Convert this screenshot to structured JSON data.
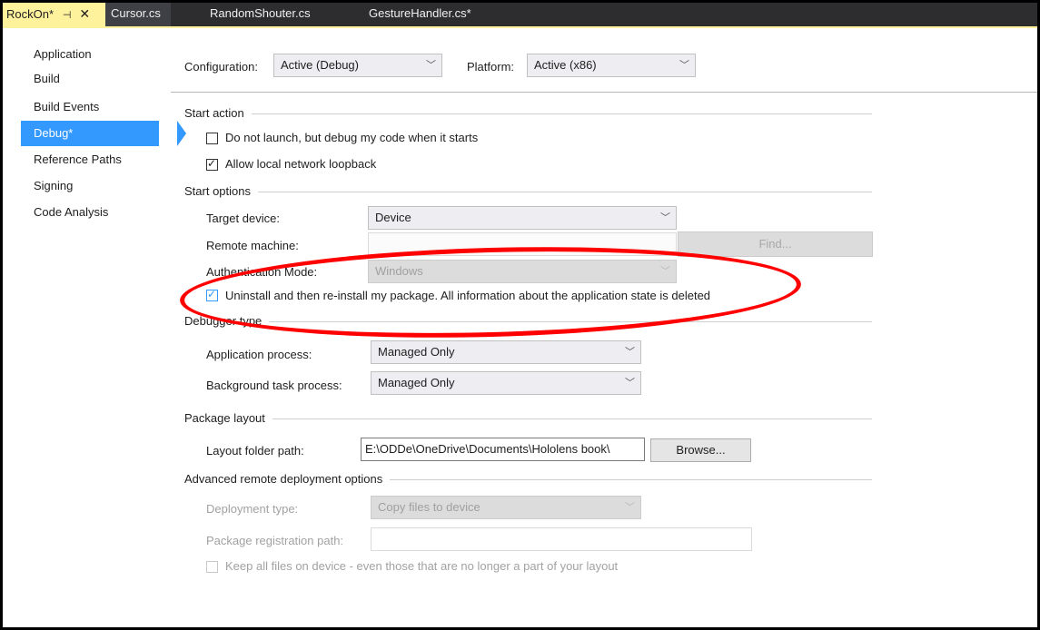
{
  "tabs": [
    {
      "label": "RockOn*",
      "active": true
    },
    {
      "label": "Cursor.cs"
    },
    {
      "label": "RandomShouter.cs"
    },
    {
      "label": "GestureHandler.cs*"
    }
  ],
  "tab_icons": {
    "pin": "pin-icon",
    "close": "close-icon"
  },
  "sidebar": {
    "items": [
      {
        "label": "Application"
      },
      {
        "label": "Build"
      },
      {
        "label": "Build Events"
      },
      {
        "label": "Debug*",
        "selected": true
      },
      {
        "label": "Reference Paths"
      },
      {
        "label": "Signing"
      },
      {
        "label": "Code Analysis"
      }
    ]
  },
  "config": {
    "configuration_label": "Configuration:",
    "configuration_value": "Active (Debug)",
    "platform_label": "Platform:",
    "platform_value": "Active (x86)"
  },
  "start_action": {
    "title": "Start action",
    "do_not_launch": {
      "label": "Do not launch, but debug my code when it starts",
      "checked": false
    },
    "loopback": {
      "label": "Allow local network loopback",
      "checked": true
    }
  },
  "start_options": {
    "title": "Start options",
    "target_device_label": "Target device:",
    "target_device_value": "Device",
    "remote_machine_label": "Remote machine:",
    "remote_machine_value": "",
    "find_button": "Find...",
    "auth_mode_label": "Authentication Mode:",
    "auth_mode_value": "Windows",
    "uninstall": {
      "label": "Uninstall and then re-install my package. All information about the application state is deleted",
      "checked": true
    }
  },
  "debugger_type": {
    "title": "Debugger type",
    "app_process_label": "Application process:",
    "app_process_value": "Managed Only",
    "bg_process_label": "Background task process:",
    "bg_process_value": "Managed Only"
  },
  "package_layout": {
    "title": "Package layout",
    "folder_label": "Layout folder path:",
    "folder_value": "E:\\ODDe\\OneDrive\\Documents\\Hololens book\\",
    "browse_button": "Browse..."
  },
  "advanced": {
    "title": "Advanced remote deployment options",
    "deployment_type_label": "Deployment type:",
    "deployment_type_value": "Copy files to device",
    "registration_path_label": "Package registration path:",
    "registration_path_value": "",
    "keep_files": {
      "label": "Keep all files on device - even those that are no longer a part of your layout",
      "checked": false
    }
  },
  "annotation_color": "#ff0000",
  "accent_color": "#3399ff"
}
